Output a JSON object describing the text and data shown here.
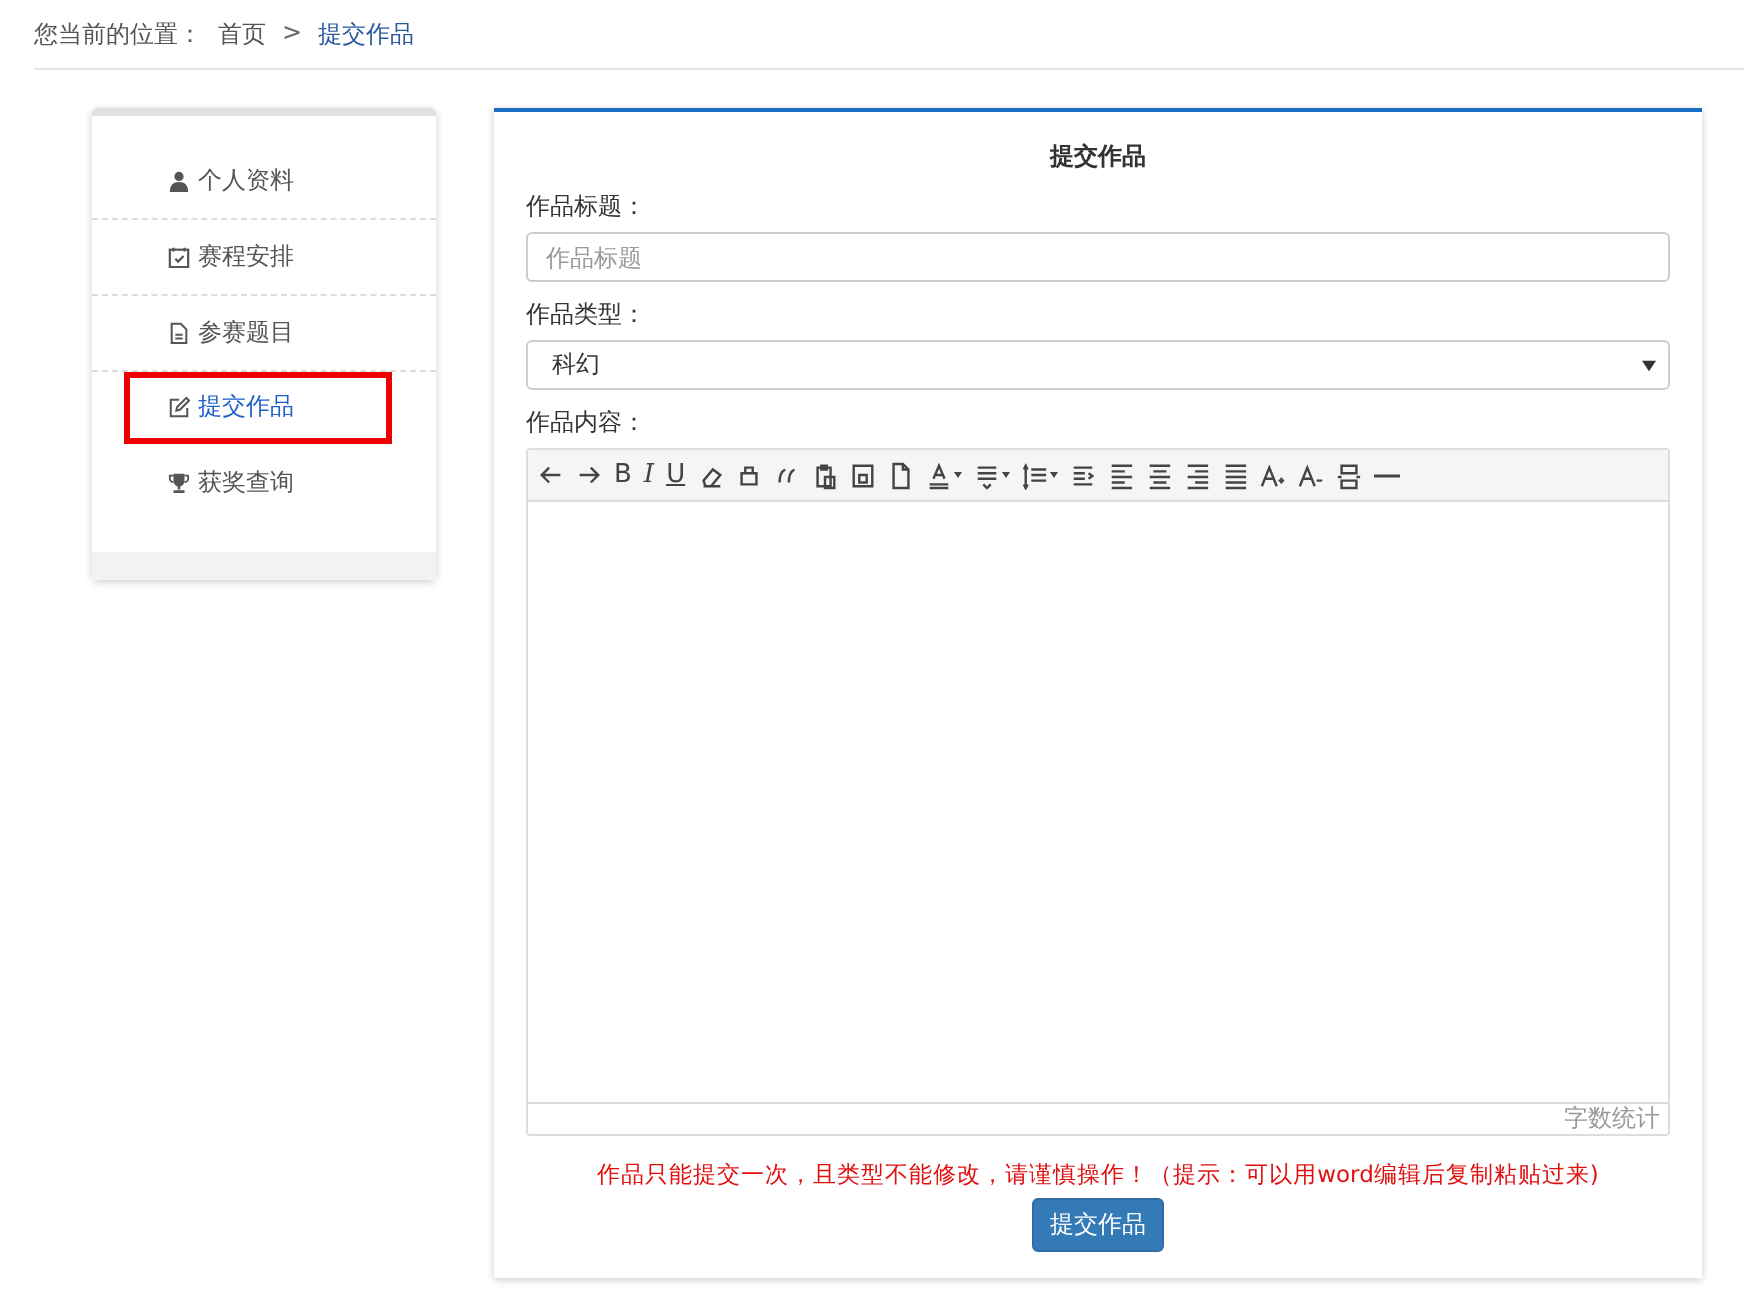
{
  "breadcrumb": {
    "label": "您当前的位置：",
    "items": [
      {
        "text": "首页",
        "current": false
      },
      {
        "text": "提交作品",
        "current": true
      }
    ],
    "separator": ">"
  },
  "sidebar": {
    "items": [
      {
        "label": "个人资料",
        "kind": "user",
        "selected": false
      },
      {
        "label": "赛程安排",
        "kind": "calendar",
        "selected": false
      },
      {
        "label": "参赛题目",
        "kind": "file",
        "selected": false
      },
      {
        "label": "提交作品",
        "kind": "edit",
        "selected": true
      },
      {
        "label": "获奖查询",
        "kind": "trophy",
        "selected": false
      }
    ]
  },
  "form": {
    "title": "提交作品",
    "title_field": {
      "label": "作品标题：",
      "placeholder": "作品标题"
    },
    "type_field": {
      "label": "作品类型：",
      "value": "科幻"
    },
    "content_field": {
      "label": "作品内容：",
      "word_count": "字数统计",
      "tools": [
        {
          "kind": "undo"
        },
        {
          "kind": "redo"
        },
        {
          "kind": "bold",
          "label": "B"
        },
        {
          "kind": "italic",
          "label": "I"
        },
        {
          "kind": "underline",
          "label": "U"
        },
        {
          "kind": "eraser"
        },
        {
          "kind": "brush"
        },
        {
          "kind": "quote"
        },
        {
          "kind": "paste"
        },
        {
          "kind": "boxed"
        },
        {
          "kind": "page"
        },
        {
          "kind": "color",
          "dropdown": true
        },
        {
          "kind": "paragraph",
          "dropdown": true
        },
        {
          "kind": "lineheight",
          "dropdown": true
        },
        {
          "kind": "indent"
        },
        {
          "kind": "left"
        },
        {
          "kind": "center"
        },
        {
          "kind": "right"
        },
        {
          "kind": "justify"
        },
        {
          "kind": "fontup"
        },
        {
          "kind": "fontdown"
        },
        {
          "kind": "pagebreak"
        },
        {
          "kind": "hr"
        }
      ]
    },
    "notice": "作品只能提交一次，且类型不能修改，请谨慎操作！（提示：可以用word编辑后复制粘贴过来)",
    "submit": "提交作品"
  }
}
